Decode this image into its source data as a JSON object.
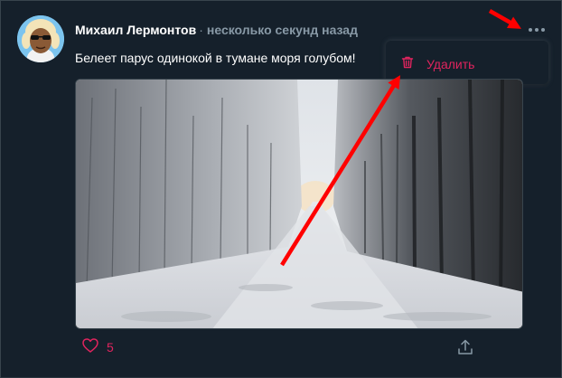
{
  "post": {
    "author": "Михаил Лермонтов",
    "separator": "·",
    "timestamp": "несколько секунд назад",
    "text": "Белеет парус одинокой в тумане моря голубом!",
    "likes": "5"
  },
  "menu": {
    "delete_label": "Удалить"
  },
  "icons": {
    "more": "ellipsis-icon",
    "delete": "trash-icon",
    "like": "heart-outline-icon",
    "share": "share-upload-icon"
  },
  "colors": {
    "background": "#15202b",
    "accent": "#e0245e",
    "muted": "#8899a6",
    "annotation_arrow": "#ff0000"
  }
}
